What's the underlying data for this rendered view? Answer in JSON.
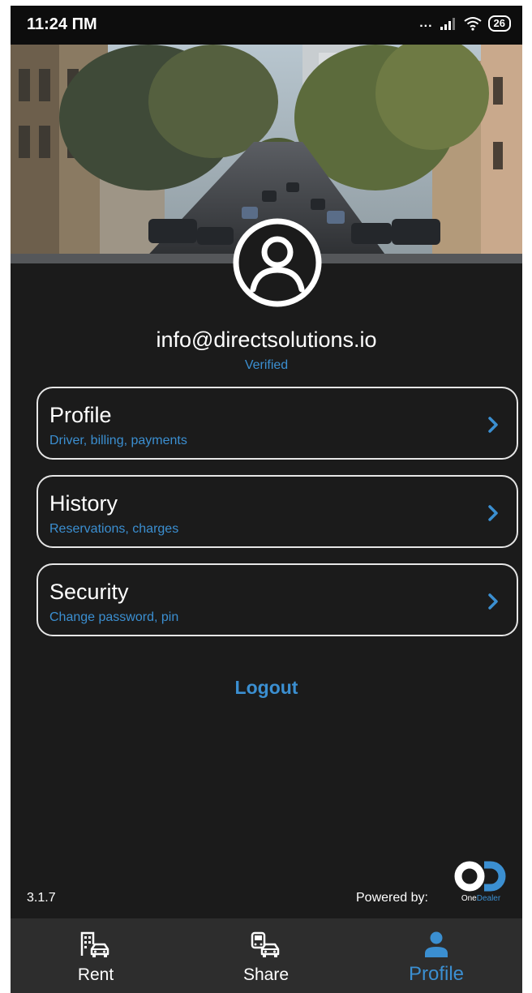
{
  "status_bar": {
    "time": "11:24 ПМ",
    "dots": "...",
    "battery": "26"
  },
  "account": {
    "email": "info@directsolutions.io",
    "status": "Verified"
  },
  "menu": [
    {
      "title": "Profile",
      "subtitle": "Driver, billing, payments",
      "icon": "chevron-right-icon"
    },
    {
      "title": "History",
      "subtitle": "Reservations, charges",
      "icon": "chevron-right-icon"
    },
    {
      "title": "Security",
      "subtitle": "Change password, pin",
      "icon": "chevron-right-icon"
    }
  ],
  "logout_label": "Logout",
  "footer": {
    "version": "3.1.7",
    "powered_by": "Powered by:",
    "logo_text_a": "One",
    "logo_text_b": "Dealer"
  },
  "bottom_nav": [
    {
      "label": "Rent",
      "icon": "building-car-icon",
      "active": false
    },
    {
      "label": "Share",
      "icon": "car-share-icon",
      "active": false
    },
    {
      "label": "Profile",
      "icon": "person-icon",
      "active": true
    }
  ],
  "colors": {
    "accent": "#3b8fd1",
    "background": "#1b1b1b",
    "nav_background": "#2d2d2d",
    "text": "#ffffff"
  }
}
